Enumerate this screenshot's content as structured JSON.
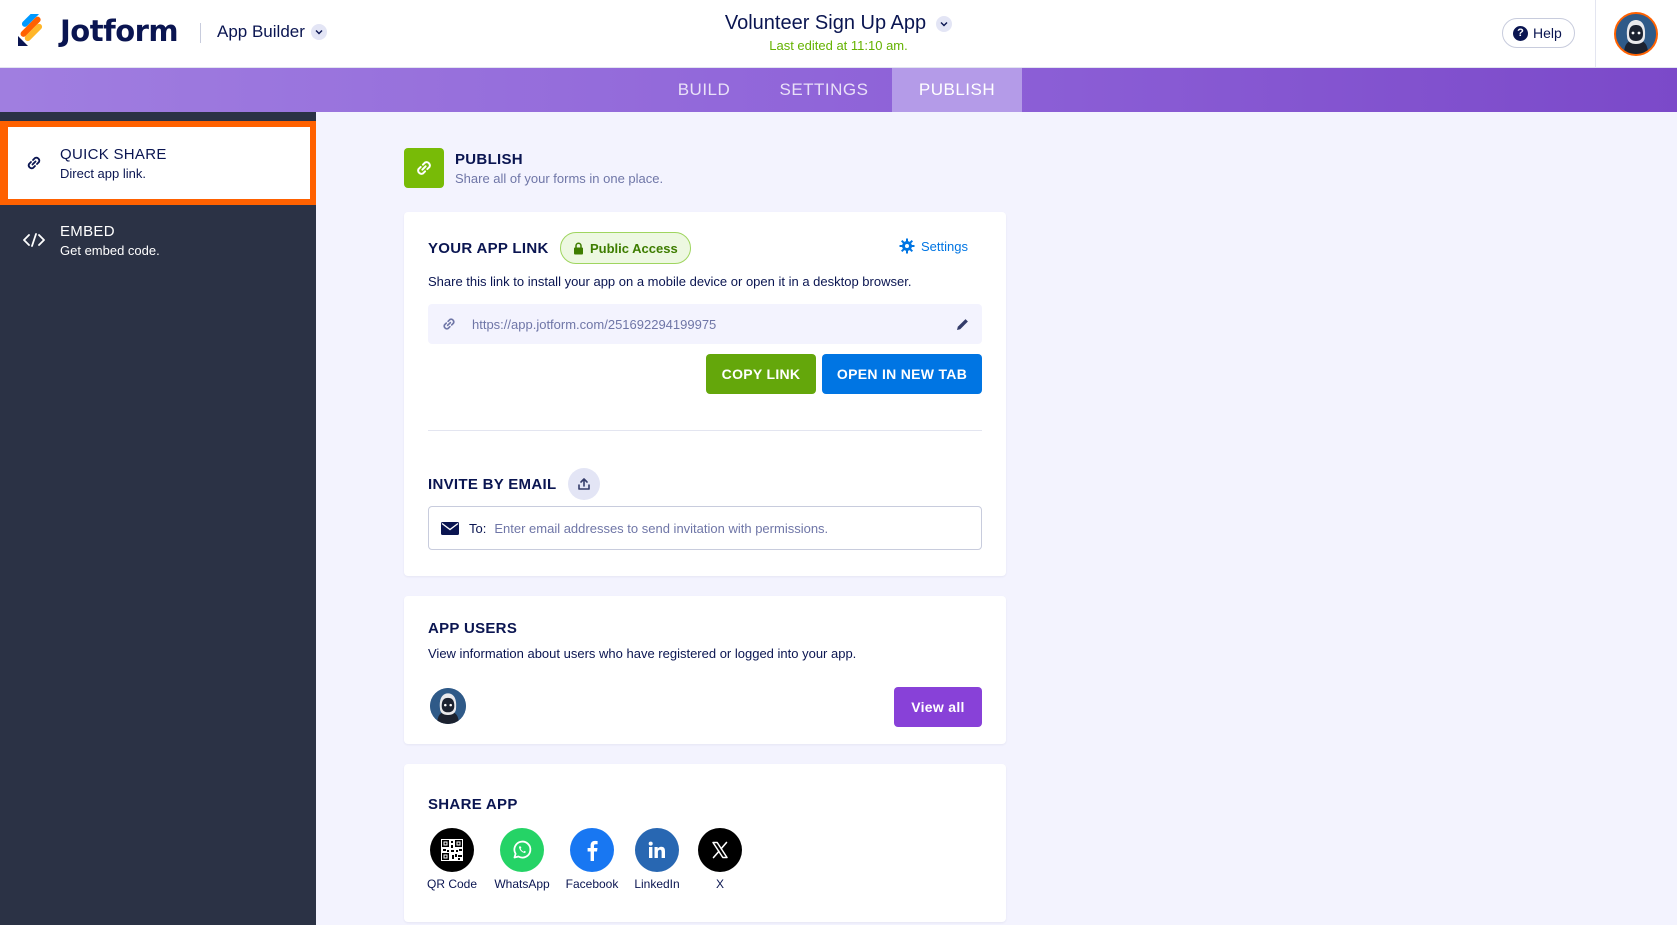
{
  "header": {
    "logo_text": "Jotform",
    "app_builder_label": "App Builder",
    "app_title": "Volunteer Sign Up App",
    "last_edited": "Last edited at 11:10 am.",
    "help_label": "Help",
    "help_icon_glyph": "?"
  },
  "tabs": [
    {
      "label": "BUILD",
      "active": false
    },
    {
      "label": "SETTINGS",
      "active": false
    },
    {
      "label": "PUBLISH",
      "active": true
    }
  ],
  "sidebar": {
    "items": [
      {
        "title": "QUICK SHARE",
        "subtitle": "Direct app link.",
        "icon": "link-icon",
        "active": true
      },
      {
        "title": "EMBED",
        "subtitle": "Get embed code.",
        "icon": "code-icon",
        "active": false
      }
    ]
  },
  "publish": {
    "title": "PUBLISH",
    "subtitle": "Share all of your forms in one place."
  },
  "app_link": {
    "title": "YOUR APP LINK",
    "access_badge": "Public Access",
    "settings_label": "Settings",
    "description": "Share this link to install your app on a mobile device or open it in a desktop browser.",
    "url": "https://app.jotform.com/251692294199975",
    "copy_label": "COPY LINK",
    "open_label": "OPEN IN NEW TAB"
  },
  "invite": {
    "title": "INVITE BY EMAIL",
    "to_label": "To:",
    "placeholder": "Enter email addresses to send invitation with permissions."
  },
  "app_users": {
    "title": "APP USERS",
    "description": "View information about users who have registered or logged into your app.",
    "view_all_label": "View all"
  },
  "share_app": {
    "title": "SHARE APP",
    "items": [
      {
        "label": "QR Code",
        "icon": "qr-code-icon",
        "color": "#000000"
      },
      {
        "label": "WhatsApp",
        "icon": "whatsapp-icon",
        "color": "#25d366"
      },
      {
        "label": "Facebook",
        "icon": "facebook-icon",
        "color": "#1877f2"
      },
      {
        "label": "LinkedIn",
        "icon": "linkedin-icon",
        "color": "#2867b2"
      },
      {
        "label": "X",
        "icon": "x-icon",
        "color": "#000000"
      }
    ]
  },
  "colors": {
    "brand_orange": "#ff6100",
    "publish_green": "#78bb07",
    "copy_green": "#64a70b",
    "open_blue": "#0075e3",
    "view_purple": "#8841d8",
    "sidebar_bg": "#2b3245"
  }
}
